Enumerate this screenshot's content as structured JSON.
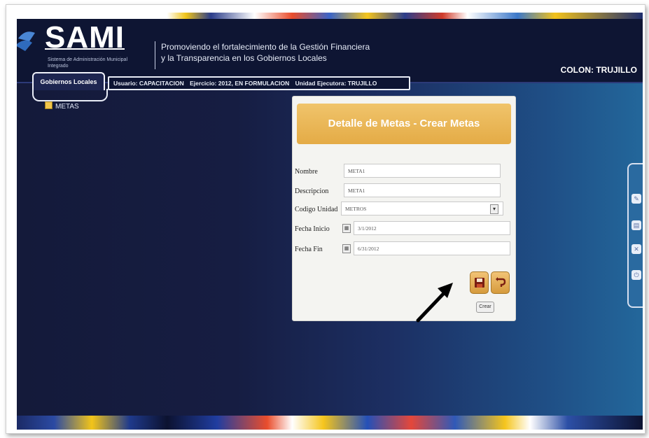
{
  "header": {
    "logo": "SAMI",
    "logo_subtitle": "Sistema de Administración Municipal Integrado",
    "tagline_1": "Promoviendo el fortalecimiento de la Gestión Financiera",
    "tagline_2": "y la Transparencia en los Gobiernos Locales",
    "region": "COLON: TRUJILLO"
  },
  "nav": {
    "tab": "Gobiernos Locales",
    "info": {
      "usuario": "Usuario: CAPACITACION",
      "ejercicio": "Ejercicio: 2012, EN FORMULACION",
      "unidad": "Unidad Ejecutora: TRUJILLO"
    }
  },
  "sidebar": {
    "item": "METAS"
  },
  "form": {
    "title": "Detalle de Metas - Crear Metas",
    "fields": {
      "nombre": {
        "label": "Nombre",
        "value": "META1"
      },
      "descripcion": {
        "label": "Descripcion",
        "value": "META1"
      },
      "codigo_unidad": {
        "label": "Codigo Unidad",
        "value": "METROS"
      },
      "fecha_inicio": {
        "label": "Fecha Inicio",
        "value": "3/1/2012"
      },
      "fecha_fin": {
        "label": "Fecha Fin",
        "value": "6/31/2012"
      }
    },
    "save_icon": "save-icon",
    "back_icon": "undo-icon",
    "button_caption": "Crear"
  },
  "colors": {
    "header_bg": "#0e1533",
    "panel_title": "#e8b356",
    "accent_blue": "#23679b"
  }
}
